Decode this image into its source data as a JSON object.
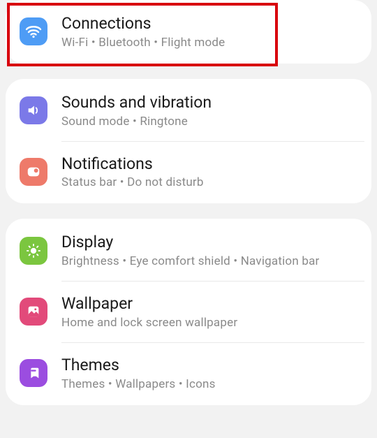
{
  "groups": [
    {
      "items": [
        {
          "key": "connections",
          "title": "Connections",
          "subtitle": "Wi-Fi  •  Bluetooth  •  Flight mode",
          "icon": "wifi-icon",
          "color": "#4e9cf5",
          "highlighted": true
        }
      ]
    },
    {
      "items": [
        {
          "key": "sounds",
          "title": "Sounds and vibration",
          "subtitle": "Sound mode  •  Ringtone",
          "icon": "speaker-icon",
          "color": "#7b79e8"
        },
        {
          "key": "notifications",
          "title": "Notifications",
          "subtitle": "Status bar  •  Do not disturb",
          "icon": "notification-icon",
          "color": "#ee7a6a"
        }
      ]
    },
    {
      "items": [
        {
          "key": "display",
          "title": "Display",
          "subtitle": "Brightness  •  Eye comfort shield  •  Navigation bar",
          "icon": "brightness-icon",
          "color": "#7bc63f"
        },
        {
          "key": "wallpaper",
          "title": "Wallpaper",
          "subtitle": "Home and lock screen wallpaper",
          "icon": "wallpaper-icon",
          "color": "#e24a7a"
        },
        {
          "key": "themes",
          "title": "Themes",
          "subtitle": "Themes  •  Wallpapers  •  Icons",
          "icon": "themes-icon",
          "color": "#9b4de0"
        }
      ]
    }
  ]
}
